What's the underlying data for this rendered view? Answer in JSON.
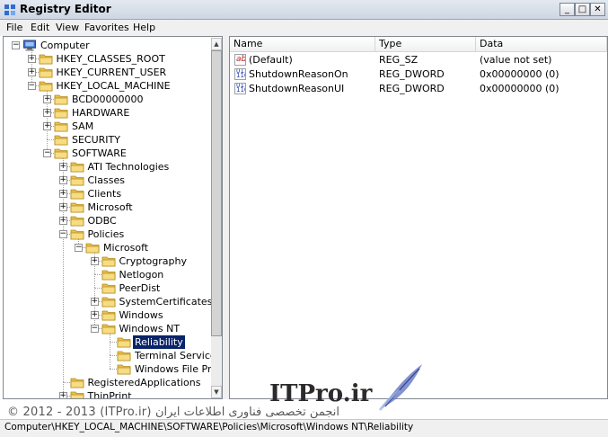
{
  "window": {
    "title": "Registry Editor"
  },
  "menu": [
    "File",
    "Edit",
    "View",
    "Favorites",
    "Help"
  ],
  "tree": [
    {
      "label": "Computer",
      "expander": "−",
      "icon": "computer-icon"
    },
    {
      "label": "HKEY_CLASSES_ROOT",
      "expander": "+",
      "icon": "folder-icon"
    },
    {
      "label": "HKEY_CURRENT_USER",
      "expander": "+",
      "icon": "folder-icon"
    },
    {
      "label": "HKEY_LOCAL_MACHINE",
      "expander": "−",
      "icon": "folder-icon"
    },
    {
      "label": "BCD00000000",
      "expander": "+",
      "icon": "folder-icon"
    },
    {
      "label": "HARDWARE",
      "expander": "+",
      "icon": "folder-icon"
    },
    {
      "label": "SAM",
      "expander": "+",
      "icon": "folder-icon"
    },
    {
      "label": "SECURITY",
      "expander": "",
      "icon": "folder-icon"
    },
    {
      "label": "SOFTWARE",
      "expander": "−",
      "icon": "folder-icon"
    },
    {
      "label": "ATI Technologies",
      "expander": "+",
      "icon": "folder-icon"
    },
    {
      "label": "Classes",
      "expander": "+",
      "icon": "folder-icon"
    },
    {
      "label": "Clients",
      "expander": "+",
      "icon": "folder-icon"
    },
    {
      "label": "Microsoft",
      "expander": "+",
      "icon": "folder-icon"
    },
    {
      "label": "ODBC",
      "expander": "+",
      "icon": "folder-icon"
    },
    {
      "label": "Policies",
      "expander": "−",
      "icon": "folder-icon"
    },
    {
      "label": "Microsoft",
      "expander": "−",
      "icon": "folder-icon"
    },
    {
      "label": "Cryptography",
      "expander": "+",
      "icon": "folder-icon"
    },
    {
      "label": "Netlogon",
      "expander": "",
      "icon": "folder-icon"
    },
    {
      "label": "PeerDist",
      "expander": "",
      "icon": "folder-icon"
    },
    {
      "label": "SystemCertificates",
      "expander": "+",
      "icon": "folder-icon"
    },
    {
      "label": "Windows",
      "expander": "+",
      "icon": "folder-icon"
    },
    {
      "label": "Windows NT",
      "expander": "−",
      "icon": "folder-icon"
    },
    {
      "label": "Reliability",
      "expander": "",
      "icon": "folder-icon",
      "selected": true
    },
    {
      "label": "Terminal Services",
      "expander": "",
      "icon": "folder-icon"
    },
    {
      "label": "Windows File Prote",
      "expander": "",
      "icon": "folder-icon"
    },
    {
      "label": "RegisteredApplications",
      "expander": "",
      "icon": "folder-icon"
    },
    {
      "label": "ThinPrint",
      "expander": "+",
      "icon": "folder-icon"
    }
  ],
  "list": {
    "columns": [
      "Name",
      "Type",
      "Data"
    ],
    "rows": [
      {
        "icon": "string-value-icon",
        "name": "(Default)",
        "type": "REG_SZ",
        "data": "(value not set)"
      },
      {
        "icon": "dword-value-icon",
        "name": "ShutdownReasonOn",
        "type": "REG_DWORD",
        "data": "0x00000000 (0)"
      },
      {
        "icon": "dword-value-icon",
        "name": "ShutdownReasonUI",
        "type": "REG_DWORD",
        "data": "0x00000000 (0)"
      }
    ]
  },
  "watermark": {
    "logo": "ITPro.ir",
    "copyright": "© 2012 - 2013 (ITPro.ir) انجمن تخصصی فناوری اطلاعات ایران"
  },
  "statusbar": {
    "path": "Computer\\HKEY_LOCAL_MACHINE\\SOFTWARE\\Policies\\Microsoft\\Windows NT\\Reliability"
  },
  "colors": {
    "selection": "#0a246a",
    "folder": "#f2d26a",
    "titlebar": "#cdd6e2"
  }
}
